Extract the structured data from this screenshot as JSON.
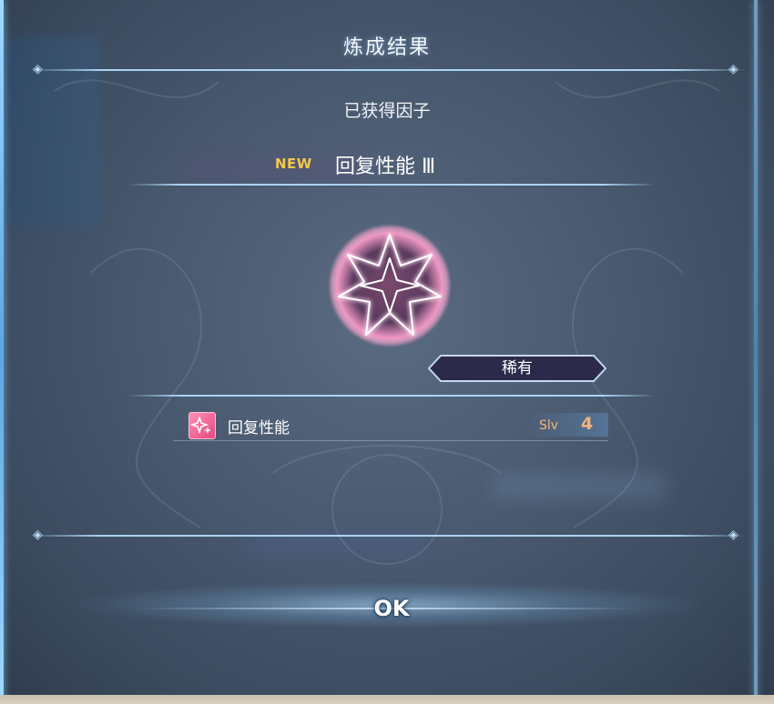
{
  "dialog": {
    "title": "炼成结果",
    "subtitle": "已获得因子",
    "new_badge": "NEW",
    "factor_name": "回复性能 Ⅲ",
    "emblem_icon": "pink-star-emblem-icon",
    "rarity": "稀有",
    "skill": {
      "icon": "sparkle-icon",
      "name": "回复性能",
      "level_label": "Slv",
      "level_value": "4"
    },
    "ok_label": "OK"
  },
  "colors": {
    "accent_gold": "#f3c94a",
    "level_orange": "#f6b27a",
    "emblem_pink": "#ff9ccc",
    "frame_blue": "#9fd8ff"
  }
}
